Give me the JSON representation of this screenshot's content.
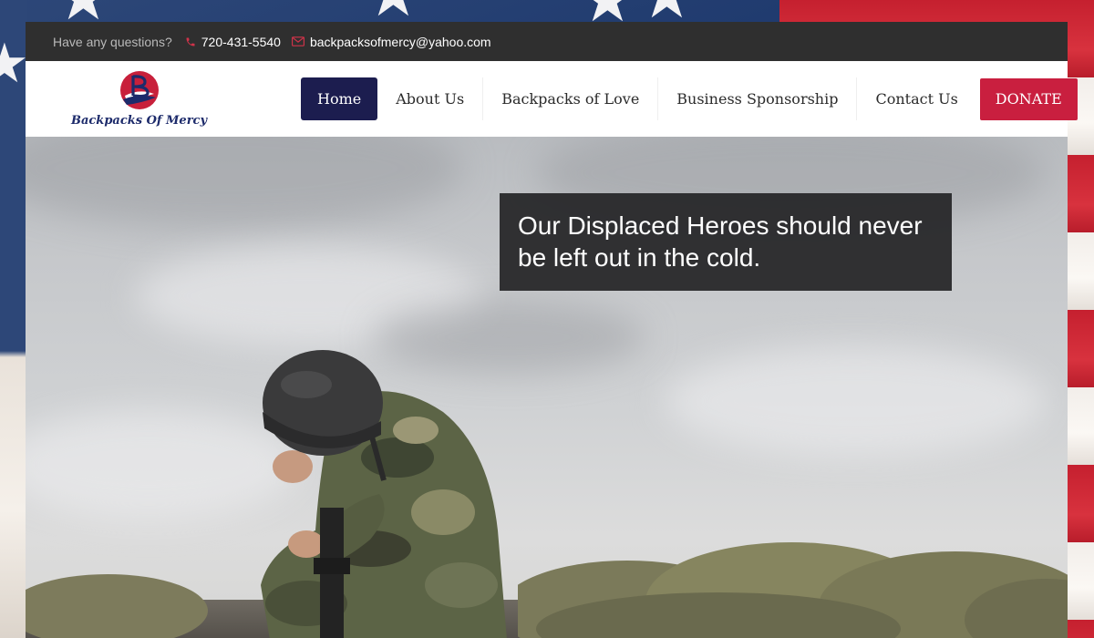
{
  "topbar": {
    "question": "Have any questions?",
    "phone": "720-431-5540",
    "email": "backpacksofmercy@yahoo.com",
    "phone_icon": "phone-icon",
    "email_icon": "envelope-icon"
  },
  "logo": {
    "text": "Backpacks Of Mercy",
    "mark_letter": "B"
  },
  "nav": {
    "items": [
      {
        "label": "Home",
        "active": true
      },
      {
        "label": "About Us"
      },
      {
        "label": "Backpacks of Love"
      },
      {
        "label": "Business Sponsorship"
      },
      {
        "label": "Contact Us"
      }
    ],
    "donate": "DONATE"
  },
  "hero": {
    "headline": "Our Displaced Heroes should never be left out in the cold."
  },
  "colors": {
    "topbar_bg": "#2f2f2f",
    "nav_active_bg": "#1c1d4f",
    "donate_bg": "#c91f3f",
    "accent_red": "#c91f3f"
  }
}
